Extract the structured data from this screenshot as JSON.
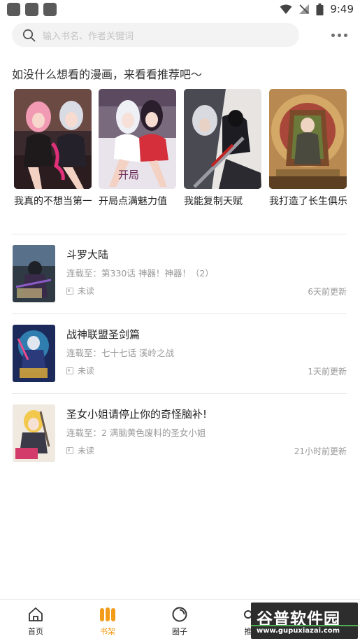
{
  "status_bar": {
    "time": "9:49"
  },
  "search": {
    "placeholder": "输入书名、作者关键词"
  },
  "recommend": {
    "heading": "如没什么想看的漫画，来看看推荐吧～",
    "items": [
      {
        "title": "我真的不想当第一仙尊",
        "cover": "pink-haired-girls-cover"
      },
      {
        "title": "开局点满魅力值",
        "cover": "two-girls-cover"
      },
      {
        "title": "我能复制天赋",
        "cover": "dark-swordsman-cover"
      },
      {
        "title": "我打造了长生俱乐部",
        "cover": "golden-throne-cover"
      }
    ]
  },
  "shelf": {
    "items": [
      {
        "title": "斗罗大陆",
        "progress": "连载至：第330话 神器！神器！（2）",
        "status": "未读",
        "updated": "6天前更新",
        "cover": "douluo-cover"
      },
      {
        "title": "战神联盟圣剑篇",
        "progress": "连载至：七十七话 溪岭之战",
        "status": "未读",
        "updated": "1天前更新",
        "cover": "zhanshen-cover"
      },
      {
        "title": "圣女小姐请停止你的奇怪脑补!",
        "progress": "连载至：2 满脑黄色废料的圣女小姐",
        "status": "未读",
        "updated": "21小时前更新",
        "cover": "saintess-cover"
      }
    ]
  },
  "nav": {
    "items": [
      {
        "label": "首页",
        "icon": "home-icon"
      },
      {
        "label": "书架",
        "icon": "bookshelf-icon"
      },
      {
        "label": "圈子",
        "icon": "circle-icon"
      },
      {
        "label": "推",
        "icon": "recommend-icon"
      }
    ],
    "active_color": "#f39c19"
  },
  "watermark": {
    "main": "谷普软件园",
    "sub": "www.gupuxiazai.com"
  }
}
